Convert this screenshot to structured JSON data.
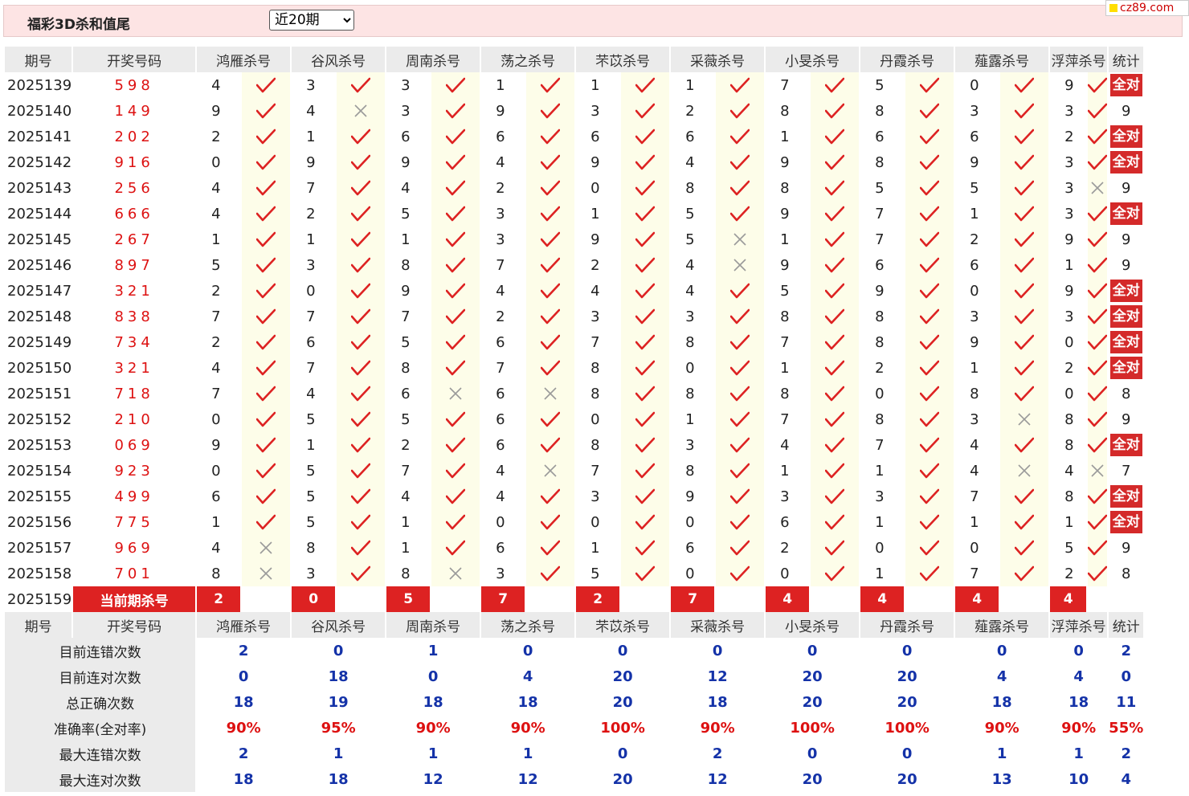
{
  "header": {
    "title": "福彩3D杀和值尾",
    "period_selected": "近20期",
    "period_options": [
      "近20期"
    ]
  },
  "site": {
    "logo_text": "cz89.com"
  },
  "columns": [
    "期号",
    "开奖号码",
    "鸿雁杀号",
    "谷风杀号",
    "周南杀号",
    "荡之杀号",
    "芣苡杀号",
    "采薇杀号",
    "小旻杀号",
    "丹霞杀号",
    "薤露杀号",
    "浮萍杀号",
    "统计"
  ],
  "all_correct_label": "全对",
  "current_label": "当前期杀号",
  "rows": [
    {
      "period": "2025139",
      "result": "598",
      "nums": [
        "4",
        "3",
        "3",
        "1",
        "1",
        "1",
        "7",
        "5",
        "0",
        "9"
      ],
      "marks": [
        "y",
        "y",
        "y",
        "y",
        "y",
        "y",
        "y",
        "y",
        "y",
        "y"
      ],
      "stat": "全对"
    },
    {
      "period": "2025140",
      "result": "149",
      "nums": [
        "9",
        "4",
        "3",
        "9",
        "3",
        "2",
        "8",
        "8",
        "3",
        "3"
      ],
      "marks": [
        "y",
        "n",
        "y",
        "y",
        "y",
        "y",
        "y",
        "y",
        "y",
        "y"
      ],
      "stat": "9"
    },
    {
      "period": "2025141",
      "result": "202",
      "nums": [
        "2",
        "1",
        "6",
        "6",
        "6",
        "6",
        "1",
        "6",
        "6",
        "2"
      ],
      "marks": [
        "y",
        "y",
        "y",
        "y",
        "y",
        "y",
        "y",
        "y",
        "y",
        "y"
      ],
      "stat": "全对"
    },
    {
      "period": "2025142",
      "result": "916",
      "nums": [
        "0",
        "9",
        "9",
        "4",
        "9",
        "4",
        "9",
        "8",
        "9",
        "3"
      ],
      "marks": [
        "y",
        "y",
        "y",
        "y",
        "y",
        "y",
        "y",
        "y",
        "y",
        "y"
      ],
      "stat": "全对"
    },
    {
      "period": "2025143",
      "result": "256",
      "nums": [
        "4",
        "7",
        "4",
        "2",
        "0",
        "8",
        "8",
        "5",
        "5",
        "3"
      ],
      "marks": [
        "y",
        "y",
        "y",
        "y",
        "y",
        "y",
        "y",
        "y",
        "y",
        "n"
      ],
      "stat": "9"
    },
    {
      "period": "2025144",
      "result": "666",
      "nums": [
        "4",
        "2",
        "5",
        "3",
        "1",
        "5",
        "9",
        "7",
        "1",
        "3"
      ],
      "marks": [
        "y",
        "y",
        "y",
        "y",
        "y",
        "y",
        "y",
        "y",
        "y",
        "y"
      ],
      "stat": "全对"
    },
    {
      "period": "2025145",
      "result": "267",
      "nums": [
        "1",
        "1",
        "1",
        "3",
        "9",
        "5",
        "1",
        "7",
        "2",
        "9"
      ],
      "marks": [
        "y",
        "y",
        "y",
        "y",
        "y",
        "n",
        "y",
        "y",
        "y",
        "y"
      ],
      "stat": "9"
    },
    {
      "period": "2025146",
      "result": "897",
      "nums": [
        "5",
        "3",
        "8",
        "7",
        "2",
        "4",
        "9",
        "6",
        "6",
        "1"
      ],
      "marks": [
        "y",
        "y",
        "y",
        "y",
        "y",
        "n",
        "y",
        "y",
        "y",
        "y"
      ],
      "stat": "9"
    },
    {
      "period": "2025147",
      "result": "321",
      "nums": [
        "2",
        "0",
        "9",
        "4",
        "4",
        "4",
        "5",
        "9",
        "0",
        "9"
      ],
      "marks": [
        "y",
        "y",
        "y",
        "y",
        "y",
        "y",
        "y",
        "y",
        "y",
        "y"
      ],
      "stat": "全对"
    },
    {
      "period": "2025148",
      "result": "838",
      "nums": [
        "7",
        "7",
        "7",
        "2",
        "3",
        "3",
        "8",
        "8",
        "3",
        "3"
      ],
      "marks": [
        "y",
        "y",
        "y",
        "y",
        "y",
        "y",
        "y",
        "y",
        "y",
        "y"
      ],
      "stat": "全对"
    },
    {
      "period": "2025149",
      "result": "734",
      "nums": [
        "2",
        "6",
        "5",
        "6",
        "7",
        "8",
        "7",
        "8",
        "9",
        "0"
      ],
      "marks": [
        "y",
        "y",
        "y",
        "y",
        "y",
        "y",
        "y",
        "y",
        "y",
        "y"
      ],
      "stat": "全对"
    },
    {
      "period": "2025150",
      "result": "321",
      "nums": [
        "4",
        "7",
        "8",
        "7",
        "8",
        "0",
        "1",
        "2",
        "1",
        "2"
      ],
      "marks": [
        "y",
        "y",
        "y",
        "y",
        "y",
        "y",
        "y",
        "y",
        "y",
        "y"
      ],
      "stat": "全对"
    },
    {
      "period": "2025151",
      "result": "718",
      "nums": [
        "7",
        "4",
        "6",
        "6",
        "8",
        "8",
        "8",
        "0",
        "8",
        "0"
      ],
      "marks": [
        "y",
        "y",
        "n",
        "n",
        "y",
        "y",
        "y",
        "y",
        "y",
        "y"
      ],
      "stat": "8"
    },
    {
      "period": "2025152",
      "result": "210",
      "nums": [
        "0",
        "5",
        "5",
        "6",
        "0",
        "1",
        "7",
        "8",
        "3",
        "8"
      ],
      "marks": [
        "y",
        "y",
        "y",
        "y",
        "y",
        "y",
        "y",
        "y",
        "n",
        "y"
      ],
      "stat": "9"
    },
    {
      "period": "2025153",
      "result": "069",
      "nums": [
        "9",
        "1",
        "2",
        "6",
        "8",
        "3",
        "4",
        "7",
        "4",
        "8"
      ],
      "marks": [
        "y",
        "y",
        "y",
        "y",
        "y",
        "y",
        "y",
        "y",
        "y",
        "y"
      ],
      "stat": "全对"
    },
    {
      "period": "2025154",
      "result": "923",
      "nums": [
        "0",
        "5",
        "7",
        "4",
        "7",
        "8",
        "1",
        "1",
        "4",
        "4"
      ],
      "marks": [
        "y",
        "y",
        "y",
        "n",
        "y",
        "y",
        "y",
        "y",
        "n",
        "n"
      ],
      "stat": "7"
    },
    {
      "period": "2025155",
      "result": "499",
      "nums": [
        "6",
        "5",
        "4",
        "4",
        "3",
        "9",
        "3",
        "3",
        "7",
        "8"
      ],
      "marks": [
        "y",
        "y",
        "y",
        "y",
        "y",
        "y",
        "y",
        "y",
        "y",
        "y"
      ],
      "stat": "全对"
    },
    {
      "period": "2025156",
      "result": "775",
      "nums": [
        "1",
        "5",
        "1",
        "0",
        "0",
        "0",
        "6",
        "1",
        "1",
        "1"
      ],
      "marks": [
        "y",
        "y",
        "y",
        "y",
        "y",
        "y",
        "y",
        "y",
        "y",
        "y"
      ],
      "stat": "全对"
    },
    {
      "period": "2025157",
      "result": "969",
      "nums": [
        "4",
        "8",
        "1",
        "6",
        "1",
        "6",
        "2",
        "0",
        "0",
        "5"
      ],
      "marks": [
        "n",
        "y",
        "y",
        "y",
        "y",
        "y",
        "y",
        "y",
        "y",
        "y"
      ],
      "stat": "9"
    },
    {
      "period": "2025158",
      "result": "701",
      "nums": [
        "8",
        "3",
        "8",
        "3",
        "5",
        "0",
        "0",
        "1",
        "7",
        "2"
      ],
      "marks": [
        "n",
        "y",
        "n",
        "y",
        "y",
        "y",
        "y",
        "y",
        "y",
        "y"
      ],
      "stat": "8"
    }
  ],
  "current": {
    "period": "2025159",
    "kills": [
      "2",
      "0",
      "5",
      "7",
      "2",
      "7",
      "4",
      "4",
      "4",
      "4"
    ]
  },
  "summary": [
    {
      "label": "目前连错次数",
      "values": [
        "2",
        "0",
        "1",
        "0",
        "0",
        "0",
        "0",
        "0",
        "0",
        "0"
      ],
      "stat": "2",
      "color": "blue"
    },
    {
      "label": "目前连对次数",
      "values": [
        "0",
        "18",
        "0",
        "4",
        "20",
        "12",
        "20",
        "20",
        "4",
        "4"
      ],
      "stat": "0",
      "color": "blue"
    },
    {
      "label": "总正确次数",
      "values": [
        "18",
        "19",
        "18",
        "18",
        "20",
        "18",
        "20",
        "20",
        "18",
        "18"
      ],
      "stat": "11",
      "color": "blue"
    },
    {
      "label": "准确率(全对率)",
      "values": [
        "90%",
        "95%",
        "90%",
        "90%",
        "100%",
        "90%",
        "100%",
        "100%",
        "90%",
        "90%"
      ],
      "stat": "55%",
      "color": "red"
    },
    {
      "label": "最大连错次数",
      "values": [
        "2",
        "1",
        "1",
        "1",
        "0",
        "2",
        "0",
        "0",
        "1",
        "1"
      ],
      "stat": "2",
      "color": "blue"
    },
    {
      "label": "最大连对次数",
      "values": [
        "18",
        "18",
        "12",
        "12",
        "20",
        "12",
        "20",
        "20",
        "13",
        "10"
      ],
      "stat": "4",
      "color": "blue"
    }
  ]
}
